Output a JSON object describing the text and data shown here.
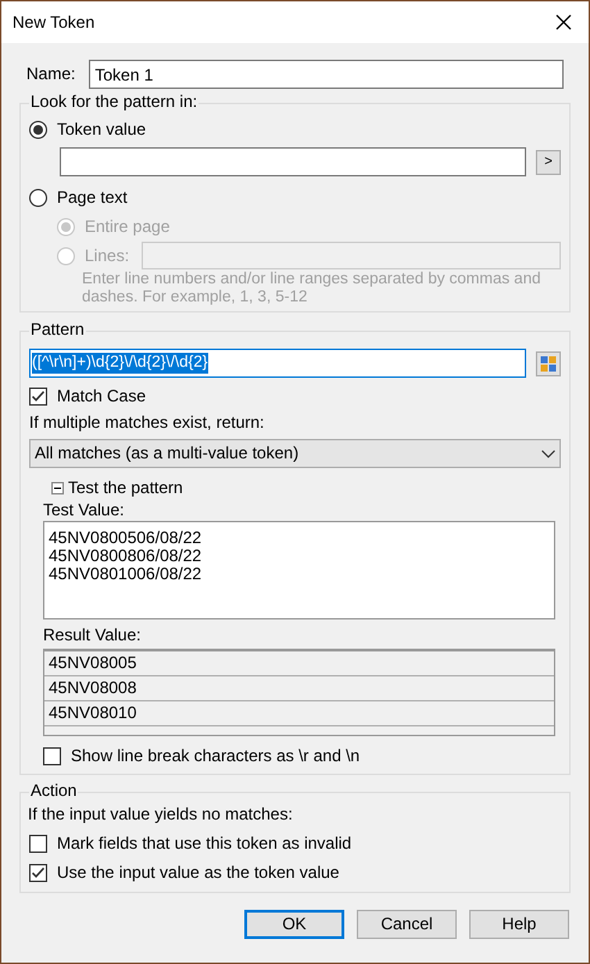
{
  "window": {
    "title": "New Token"
  },
  "name": {
    "label": "Name:",
    "value": "Token 1"
  },
  "look_for": {
    "title": "Look for the pattern in:",
    "options": [
      {
        "label": "Token value",
        "selected": true,
        "disabled": false,
        "kind": "token"
      },
      {
        "label": "Page text",
        "selected": false,
        "disabled": false,
        "kind": "page"
      }
    ],
    "token_button": ">",
    "page_options": [
      {
        "label": "Entire page",
        "selected": true,
        "disabled": true,
        "kind": "plain"
      },
      {
        "label": "Lines:",
        "selected": false,
        "disabled": true,
        "kind": "lines"
      }
    ],
    "hint": "Enter line numbers and/or line ranges separated by commas and dashes.  For example, 1, 3, 5-12"
  },
  "pattern": {
    "title": "Pattern",
    "value": "([^\\r\\n]+)\\d{2}\\/\\d{2}\\/\\d{2}",
    "selected": true,
    "match_case": {
      "label": "Match Case",
      "checked": true
    },
    "multiple_label": "If multiple matches exist, return:",
    "multiple_value": "All matches (as a multi-value token)",
    "test": {
      "label": "Test the pattern",
      "expanded": true,
      "test_value_label": "Test Value:",
      "test_lines": [
        "45NV0800506/08/22",
        "45NV0800806/08/22",
        "45NV0801006/08/22"
      ],
      "result_label": "Result Value:",
      "results": [
        "45NV08005",
        "45NV08008",
        "45NV08010"
      ]
    },
    "show_breaks": {
      "label": "Show line break characters as \\r and \\n",
      "checked": false
    }
  },
  "action": {
    "title": "Action",
    "prompt": "If the input value yields no matches:",
    "options": [
      {
        "label": "Mark fields that use this token as invalid",
        "checked": false
      },
      {
        "label": "Use the input value as the token value",
        "checked": true
      }
    ]
  },
  "buttons": [
    {
      "label": "OK",
      "default": true
    },
    {
      "label": "Cancel",
      "default": false
    },
    {
      "label": "Help",
      "default": false
    }
  ]
}
